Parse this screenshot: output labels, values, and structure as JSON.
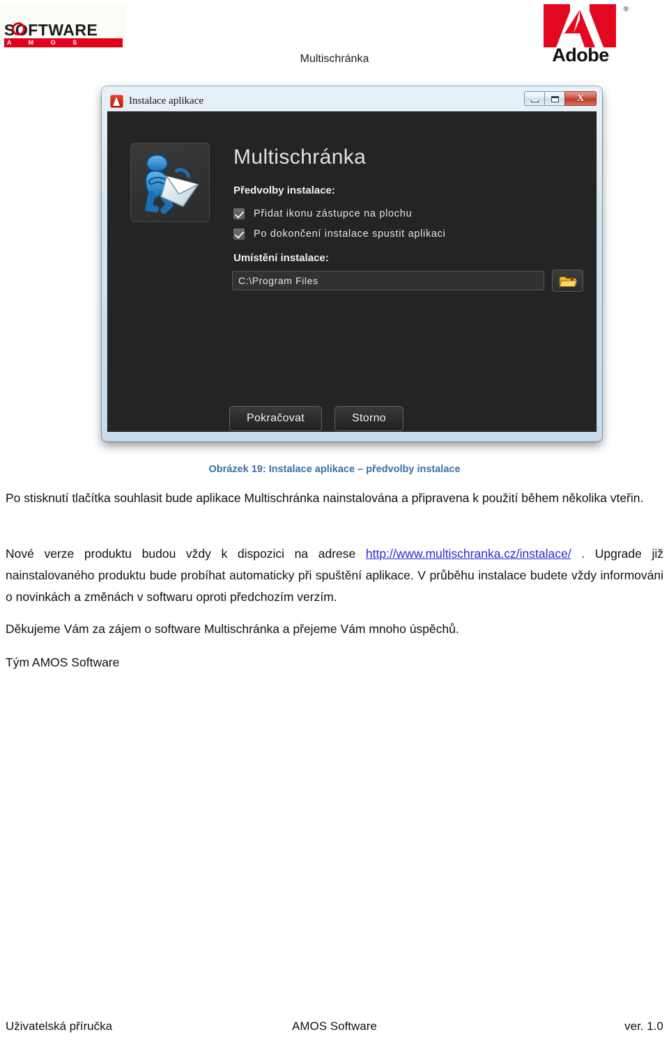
{
  "header": {
    "doc_title": "Multischránka",
    "left_logo": {
      "word": "SOFTWARE",
      "subword": "AMOS",
      "letters": "A M O S"
    },
    "right_logo": {
      "name": "Adobe",
      "registered": "®"
    }
  },
  "screenshot": {
    "window": {
      "title": "Instalace aplikace",
      "controls": {
        "minimize": "–",
        "maximize": "□",
        "close": "X"
      }
    },
    "app_name": "Multischránka",
    "prefs_label": "Předvolby instalace:",
    "checkboxes": [
      {
        "label": "Přidat ikonu zástupce na plochu",
        "checked": true
      },
      {
        "label": "Po dokončení instalace spustit aplikaci",
        "checked": true
      }
    ],
    "location_label": "Umístění instalace:",
    "location_value": "C:\\Program Files",
    "browse_icon": "folder-open-icon",
    "buttons": {
      "primary": "Pokračovat",
      "secondary": "Storno"
    }
  },
  "caption": "Obrázek 19: Instalace aplikace – předvolby instalace",
  "body": {
    "p1": "Po stisknutí tlačítka souhlasit bude aplikace Multischránka nainstalována a připravena k použití během několika vteřin.",
    "p2_before": "Nové verze produktu budou vždy k dispozici na  adrese ",
    "p2_link": "http://www.multischranka.cz/instalace/",
    "p2_after": " . Upgrade již nainstalovaného produktu bude probíhat automaticky při spuštění aplikace. V průběhu instalace budete vždy informováni o novinkách a změnách v softwaru oproti předchozím verzím.",
    "p3": "Děkujeme Vám za zájem o software Multischránka a přejeme Vám mnoho úspěchů.",
    "p4": "Tým AMOS Software"
  },
  "footer": {
    "left": "Uživatelská příručka",
    "center": "AMOS Software",
    "right": "ver. 1.0"
  },
  "colors": {
    "brand_red": "#e2001a",
    "adobe_red": "#e3071f",
    "caption_blue": "#3d6fa8",
    "link_blue": "#2a2ad0",
    "dialog_bg": "#242424"
  }
}
